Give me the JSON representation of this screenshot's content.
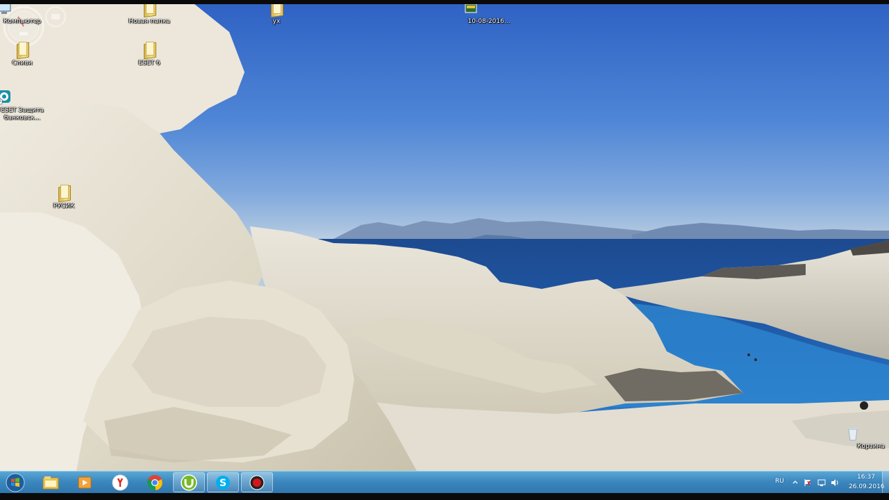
{
  "desktop": {
    "icons": [
      {
        "label": "Компьютер",
        "icon": "computer-icon"
      },
      {
        "label": "Новая папка",
        "icon": "folder-icon"
      },
      {
        "label": "ух",
        "icon": "folder-icon"
      },
      {
        "label": "10-08-2016...",
        "icon": "image-file-icon"
      },
      {
        "label": "Сливи",
        "icon": "folder-icon"
      },
      {
        "label": "ESET 6",
        "icon": "folder-icon"
      },
      {
        "label": "ESET Защита банковск...",
        "icon": "eset-shortcut-icon"
      },
      {
        "label": "РУСИК",
        "icon": "folder-icon"
      },
      {
        "label": "Корзина",
        "icon": "recycle-bin-icon"
      }
    ],
    "gadget": {
      "name": "cpu-meter-gadget"
    }
  },
  "taskbar": {
    "start": {
      "icon": "windows-start-orb-icon"
    },
    "pinned": [
      {
        "name": "explorer",
        "icon": "folder-explorer-icon"
      },
      {
        "name": "media-player",
        "icon": "media-player-icon"
      },
      {
        "name": "yandex-browser",
        "icon": "yandex-browser-icon"
      },
      {
        "name": "chrome",
        "icon": "chrome-icon"
      },
      {
        "name": "utorrent",
        "icon": "utorrent-icon"
      },
      {
        "name": "skype",
        "icon": "skype-icon"
      },
      {
        "name": "recorder",
        "icon": "record-icon"
      }
    ],
    "tray": {
      "language": "RU",
      "icons": [
        "show-hidden-icons-arrow",
        "action-center-flag-icon",
        "network-icon",
        "volume-icon"
      ],
      "time": "16:37",
      "date": "26.09.2016"
    }
  },
  "colors": {
    "taskbar": "#3c88bf",
    "sky_top": "#2f62c4",
    "sea": "#1f4f95",
    "rock": "#e6e0d0"
  }
}
